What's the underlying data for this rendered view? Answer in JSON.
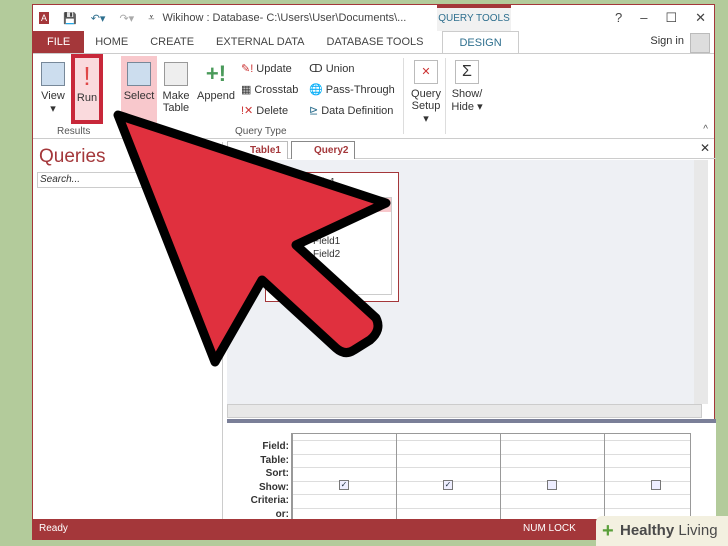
{
  "window": {
    "title": "Wikihow : Database- C:\\Users\\User\\Documents\\...",
    "context_tab": "QUERY TOOLS",
    "controls": [
      "?",
      "–",
      "☐",
      "✕"
    ]
  },
  "tabs": [
    {
      "label": "FILE"
    },
    {
      "label": "HOME"
    },
    {
      "label": "CREATE"
    },
    {
      "label": "EXTERNAL DATA"
    },
    {
      "label": "DATABASE TOOLS"
    },
    {
      "label": "DESIGN"
    }
  ],
  "sign_in": "Sign in",
  "ribbon": {
    "view": "View",
    "run": "Run",
    "select": "Select",
    "make_table": "Make Table",
    "append": "Append",
    "update": "Update",
    "crosstab": "Crosstab",
    "delete": "Delete",
    "union": "Union",
    "pass_through": "Pass-Through",
    "data_definition": "Data Definition",
    "query_setup": "Query Setup",
    "show_hide": "Show/ Hide",
    "group_results": "Results",
    "group_query_type": "Query Type"
  },
  "nav": {
    "title": "Queries",
    "search_placeholder": "Search..."
  },
  "doc_tabs": [
    {
      "label": "Table1"
    },
    {
      "label": "Query2"
    }
  ],
  "table_box": {
    "title": "Table1",
    "fields": [
      "Field1",
      "Field2"
    ]
  },
  "grid": {
    "row_labels": [
      "Field:",
      "Table:",
      "Sort:",
      "Show:",
      "Criteria:",
      "or:"
    ],
    "show": [
      true,
      true,
      false,
      false
    ]
  },
  "status": {
    "left": "Ready",
    "num_lock": "NUM LOCK"
  },
  "watermark": {
    "bold": "Healthy",
    "rest": " Living"
  },
  "colors": {
    "accent": "#a4373a",
    "arrow": "#e0303e",
    "background": "#b3cb9b"
  }
}
